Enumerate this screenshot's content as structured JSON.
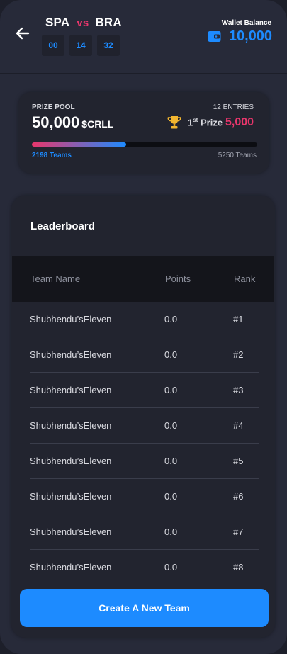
{
  "header": {
    "team_a": "SPA",
    "vs": "vs",
    "team_b": "BRA",
    "timer": [
      "00",
      "14",
      "32"
    ],
    "wallet_label": "Wallet Balance",
    "wallet_amount": "10,000"
  },
  "prize": {
    "label": "PRIZE POOL",
    "amount": "50,000",
    "currency": "$CRLL",
    "entries": "12 ENTRIES",
    "first_prize_num": "1",
    "first_prize_sup": "st",
    "first_prize_word": "Prize",
    "first_prize_amount": "5,000",
    "teams_joined": "2198 Teams",
    "teams_total": "5250 Teams",
    "fill_fraction": 0.4187
  },
  "leaderboard": {
    "title": "Leaderboard",
    "columns": {
      "name": "Team Name",
      "points": "Points",
      "rank": "Rank"
    },
    "rows": [
      {
        "name": "Shubhendu’sEleven",
        "points": "0.0",
        "rank": "#1"
      },
      {
        "name": "Shubhendu’sEleven",
        "points": "0.0",
        "rank": "#2"
      },
      {
        "name": "Shubhendu’sEleven",
        "points": "0.0",
        "rank": "#3"
      },
      {
        "name": "Shubhendu’sEleven",
        "points": "0.0",
        "rank": "#4"
      },
      {
        "name": "Shubhendu’sEleven",
        "points": "0.0",
        "rank": "#5"
      },
      {
        "name": "Shubhendu’sEleven",
        "points": "0.0",
        "rank": "#6"
      },
      {
        "name": "Shubhendu’sEleven",
        "points": "0.0",
        "rank": "#7"
      },
      {
        "name": "Shubhendu’sEleven",
        "points": "0.0",
        "rank": "#8"
      }
    ]
  },
  "cta_label": "Create A New Team",
  "icons": {
    "back": "back-arrow-icon",
    "wallet": "wallet-icon",
    "trophy": "trophy-icon"
  },
  "colors": {
    "accent": "#1d8bff",
    "pink": "#e9366c",
    "background": "#272a39",
    "card": "#22242f"
  }
}
